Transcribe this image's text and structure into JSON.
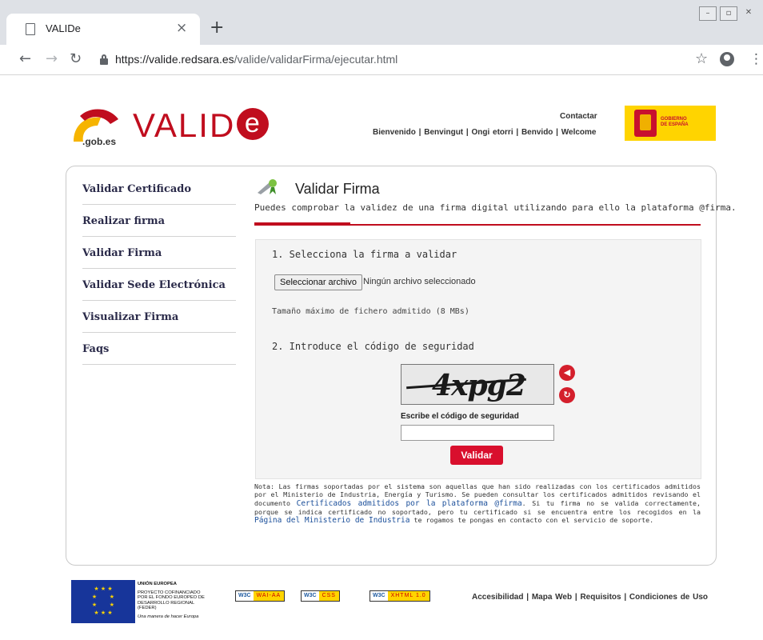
{
  "browser": {
    "tab_title": "VALIDe",
    "tab_close": "×",
    "new_tab": "+",
    "url_host": "https://valide.redsara.es",
    "url_path": "/valide/validarFirma/ejecutar.html"
  },
  "header": {
    "logo_gob": ".gob.es",
    "logo_valid": "VALID",
    "logo_e": "e",
    "contact": "Contactar",
    "languages": "Bienvenido | Benvingut | Ongi etorri | Benvido | Welcome",
    "gov_logo_line1": "GOBIERNO",
    "gov_logo_line2": "DE ESPAÑA"
  },
  "sidebar": {
    "items": [
      {
        "label": "Validar Certificado"
      },
      {
        "label": "Realizar firma"
      },
      {
        "label": "Validar Firma"
      },
      {
        "label": "Validar Sede Electrónica"
      },
      {
        "label": "Visualizar Firma"
      },
      {
        "label": "Faqs"
      }
    ]
  },
  "main": {
    "title": "Validar Firma",
    "subtitle": "Puedes comprobar la validez de una firma digital utilizando para ello la plataforma @firma.",
    "step1": "1. Selecciona la firma a validar",
    "file_button": "Seleccionar archivo",
    "file_none": "Ningún archivo seleccionado",
    "max_size": "Tamaño máximo de fichero admitido (8 MBs)",
    "step2": "2. Introduce el código de seguridad",
    "captcha_text": "4xpg2",
    "captcha_label": "Escribe el código de seguridad",
    "captcha_value": "",
    "submit": "Validar",
    "note_part1": "Nota: Las firmas soportadas por el sistema son aquellas que han sido realizadas con los certificados admitidos por el Ministerio de Industria, Energía y Turismo. Se pueden consultar los certificados admitidos revisando el documento ",
    "note_link1": "Certificados admitidos por la plataforma @firma",
    "note_part2": ". Si tu firma no se valida correctamente, porque se indica certificado no soportado, pero tu certificado si se encuentra entre los recogidos en la ",
    "note_link2": "Página del Ministerio de Industria",
    "note_part3": " te rogamos te pongas en contacto con el servicio de soporte."
  },
  "footer": {
    "eu_line1": "UNIÓN EUROPEA",
    "eu_line2": "PROYECTO COFINANCIADO",
    "eu_line3": "POR EL FONDO EUROPEO DE",
    "eu_line4": "DESARROLLO REGIONAL",
    "eu_line5": "(FEDER)",
    "eu_line6": "Una manera de hacer Europa",
    "badge1_left": "W3C",
    "badge1_right": "WAI-AA",
    "badge2_left": "W3C",
    "badge2_right": "CSS",
    "badge3_left": "W3C",
    "badge3_right": "XHTML 1.0",
    "links": "Accesibilidad | Mapa Web | Requisitos | Condiciones de Uso"
  }
}
